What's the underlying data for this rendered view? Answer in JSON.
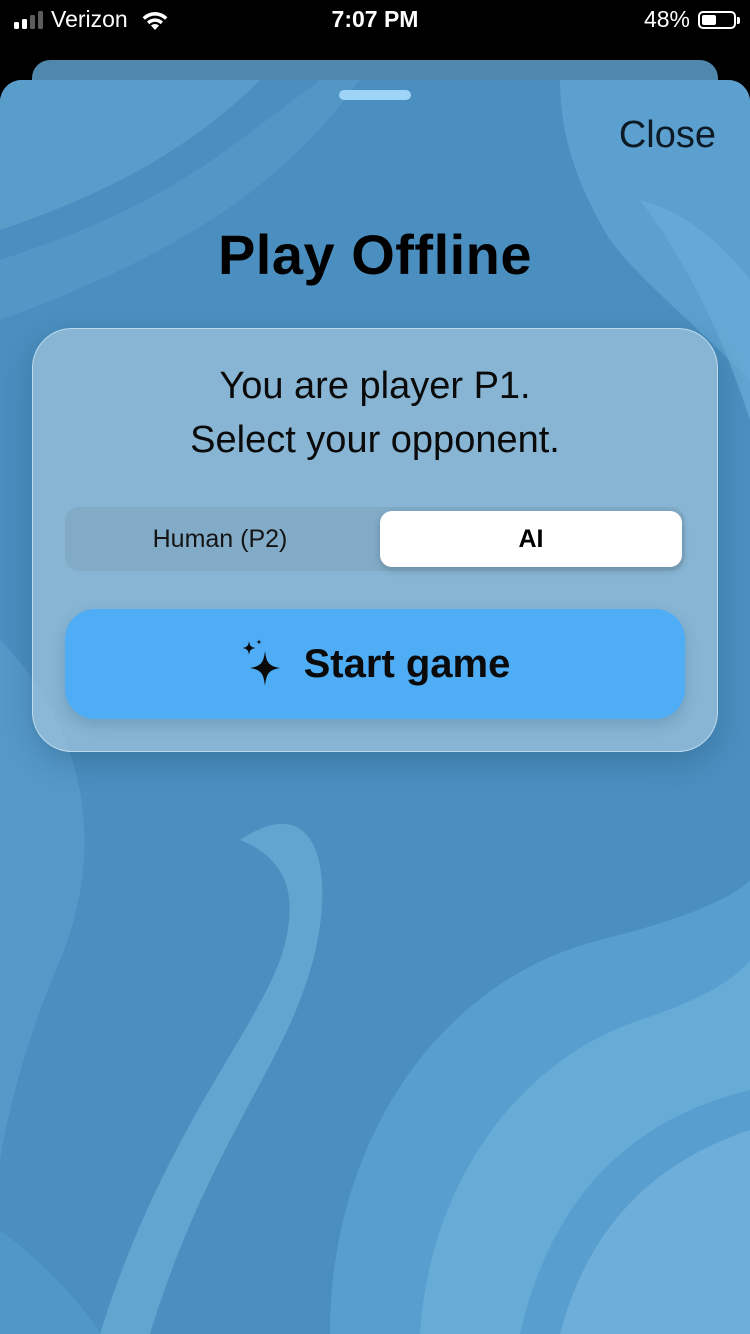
{
  "status_bar": {
    "carrier": "Verizon",
    "time": "7:07 PM",
    "battery_percent": "48%",
    "battery_level": 0.48,
    "signal_bars_active": 2,
    "signal_bars_total": 4,
    "icons": [
      "signal-icon",
      "wifi-icon",
      "battery-icon"
    ]
  },
  "sheet": {
    "close_label": "Close",
    "title": "Play Offline"
  },
  "card": {
    "prompt_line1": "You are player P1.",
    "prompt_line2": "Select your opponent.",
    "opponent_options": [
      "Human (P2)",
      "AI"
    ],
    "selected_opponent": "AI",
    "start_label": "Start game",
    "start_icon": "sparkles-icon"
  },
  "colors": {
    "background": "#4a8fbf",
    "start_button": "#4fadf5",
    "selected_segment": "#ffffff"
  }
}
